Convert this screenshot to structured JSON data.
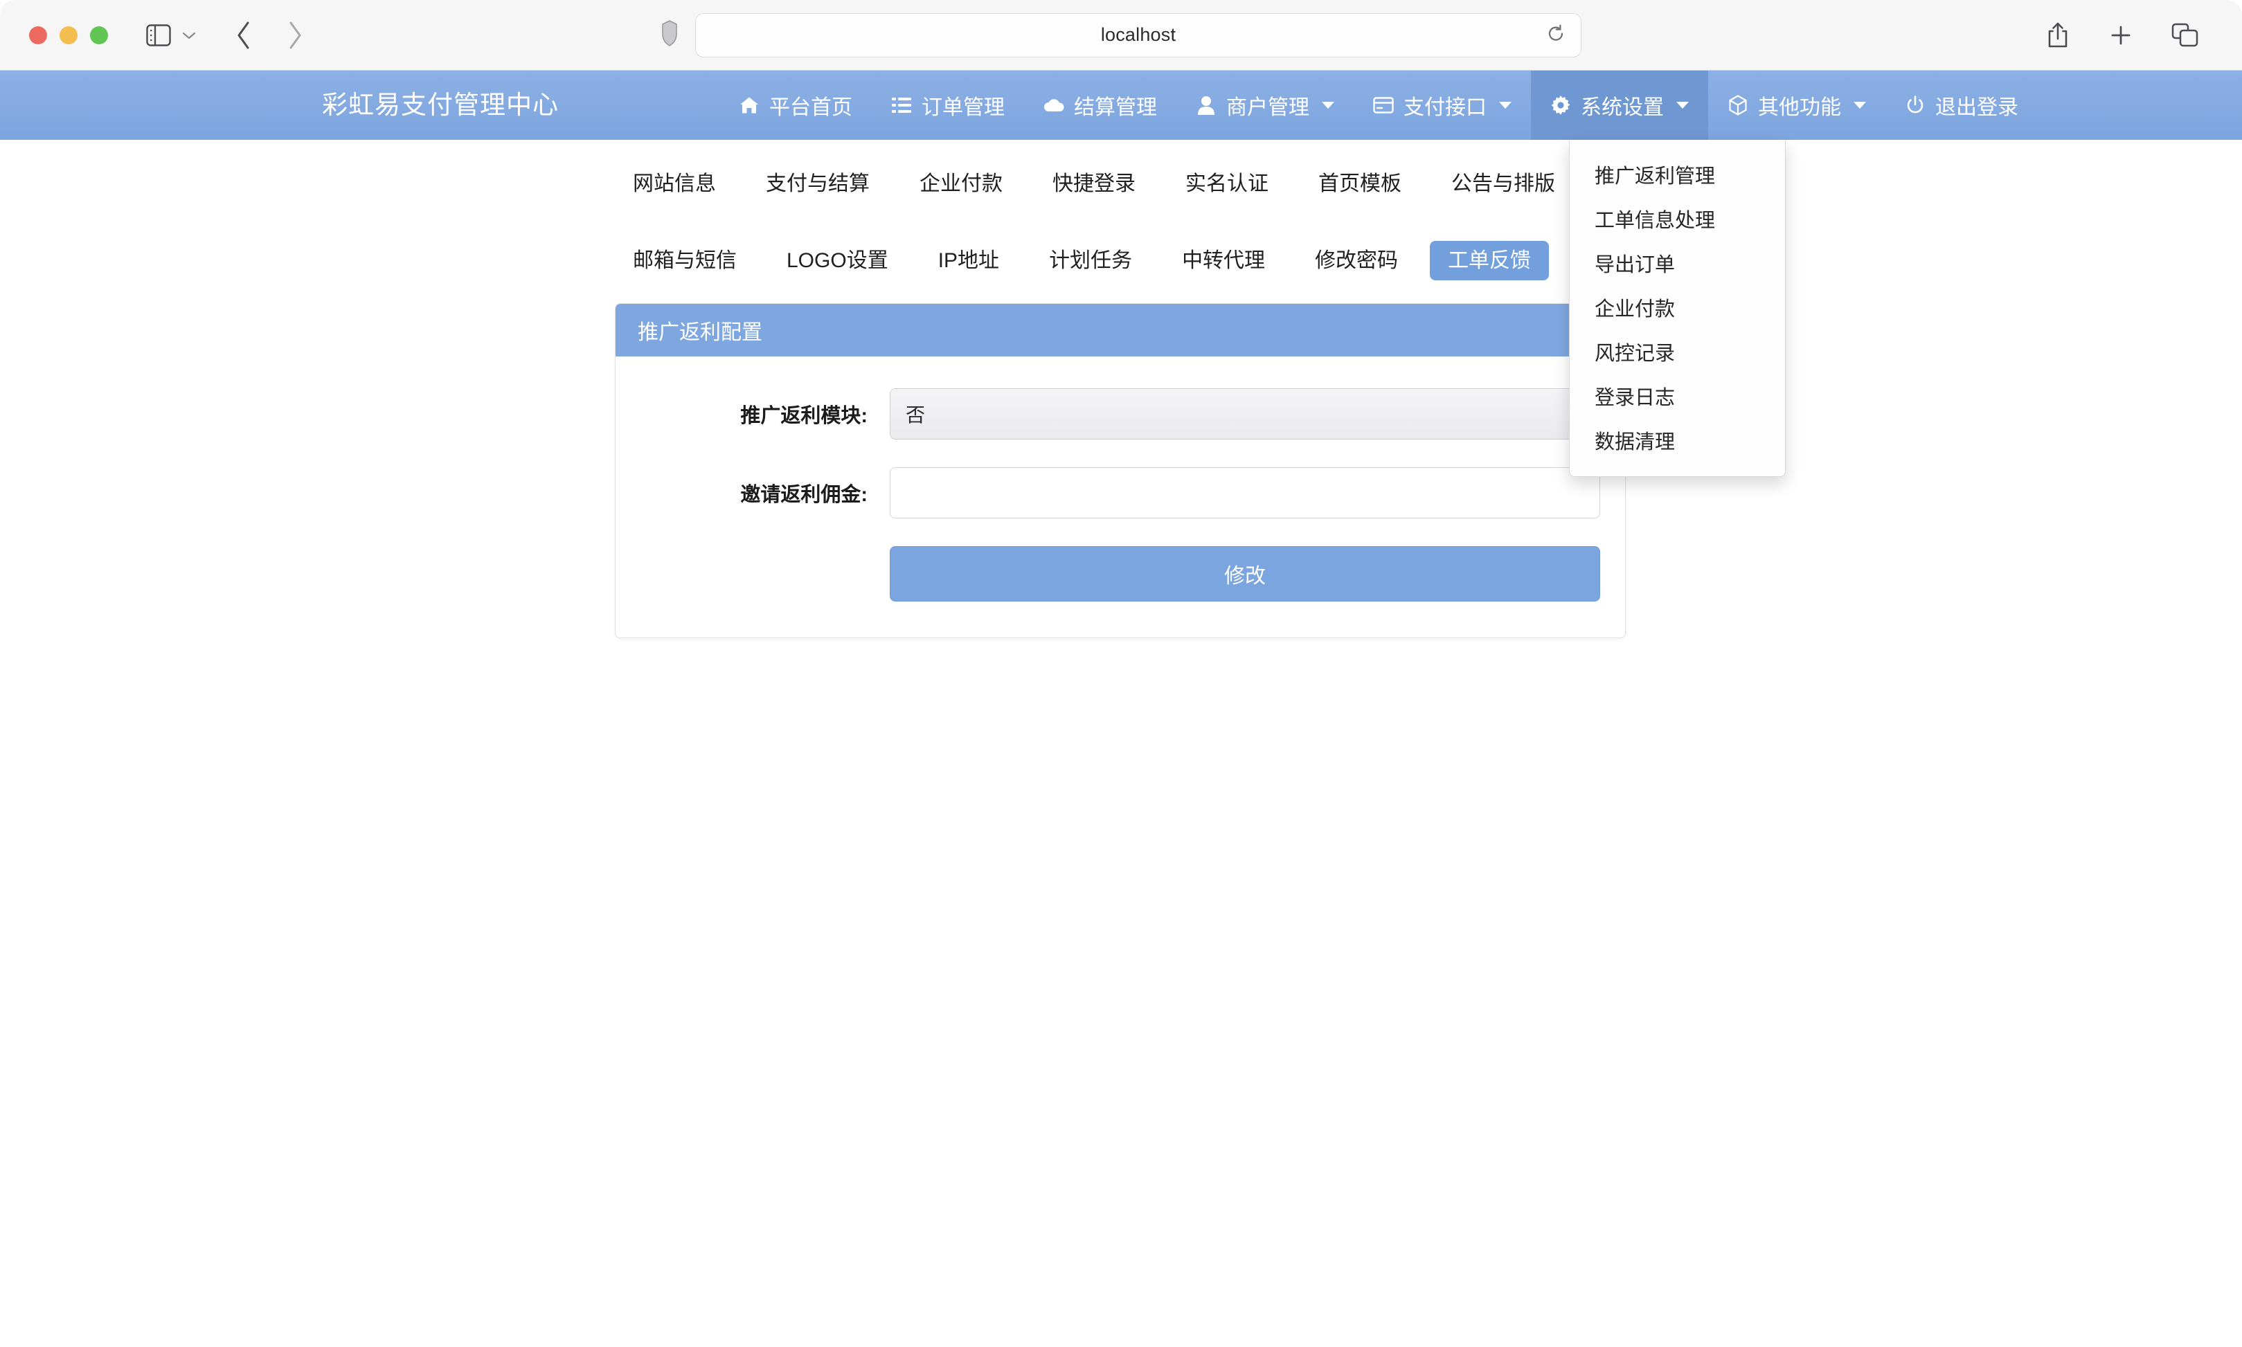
{
  "browser": {
    "url": "localhost",
    "icons": {
      "sidebar": "sidebar-icon",
      "chevron_down": "chevron-down-icon",
      "back": "back-arrow-icon",
      "forward": "forward-arrow-icon",
      "shield": "shield-icon",
      "reload": "reload-icon",
      "share": "share-icon",
      "new_tab": "plus-icon",
      "tab_overview": "tab-overview-icon"
    }
  },
  "appnav": {
    "brand": "彩虹易支付管理中心",
    "items": [
      {
        "label": "平台首页",
        "icon": "home-icon",
        "caret": false,
        "active": false
      },
      {
        "label": "订单管理",
        "icon": "list-icon",
        "caret": false,
        "active": false
      },
      {
        "label": "结算管理",
        "icon": "cloud-icon",
        "caret": false,
        "active": false
      },
      {
        "label": "商户管理",
        "icon": "user-icon",
        "caret": true,
        "active": false
      },
      {
        "label": "支付接口",
        "icon": "card-icon",
        "caret": true,
        "active": false
      },
      {
        "label": "系统设置",
        "icon": "gear-icon",
        "caret": true,
        "active": true
      },
      {
        "label": "其他功能",
        "icon": "cube-icon",
        "caret": true,
        "active": false
      },
      {
        "label": "退出登录",
        "icon": "power-icon",
        "caret": false,
        "active": false
      }
    ]
  },
  "dropdown": {
    "open_for": "系统设置",
    "items": [
      "推广返利管理",
      "工单信息处理",
      "导出订单",
      "企业付款",
      "风控记录",
      "登录日志",
      "数据清理"
    ]
  },
  "tabs": {
    "row1": [
      {
        "label": "网站信息",
        "active": false
      },
      {
        "label": "支付与结算",
        "active": false
      },
      {
        "label": "企业付款",
        "active": false
      },
      {
        "label": "快捷登录",
        "active": false
      },
      {
        "label": "实名认证",
        "active": false
      },
      {
        "label": "首页模板",
        "active": false
      },
      {
        "label": "公告与排版",
        "active": false
      }
    ],
    "row2": [
      {
        "label": "邮箱与短信",
        "active": false
      },
      {
        "label": "LOGO设置",
        "active": false
      },
      {
        "label": "IP地址",
        "active": false
      },
      {
        "label": "计划任务",
        "active": false
      },
      {
        "label": "中转代理",
        "active": false
      },
      {
        "label": "修改密码",
        "active": false
      },
      {
        "label": "工单反馈",
        "active": true
      }
    ]
  },
  "panel": {
    "title": "推广返利配置",
    "fields": [
      {
        "label": "推广返利模块:",
        "type": "select",
        "value": "否",
        "placeholder": ""
      },
      {
        "label": "邀请返利佣金:",
        "type": "text",
        "value": "",
        "placeholder": ""
      }
    ],
    "submit_label": "修改"
  },
  "colors": {
    "nav_bg": "#7da5df",
    "nav_active": "#6f97d2",
    "panel_head": "#7fa7df",
    "tab_active": "#73a0dd",
    "button": "#7ba5de",
    "page_bg": "#ffffff",
    "toolbar_bg": "#f6f6f7"
  }
}
